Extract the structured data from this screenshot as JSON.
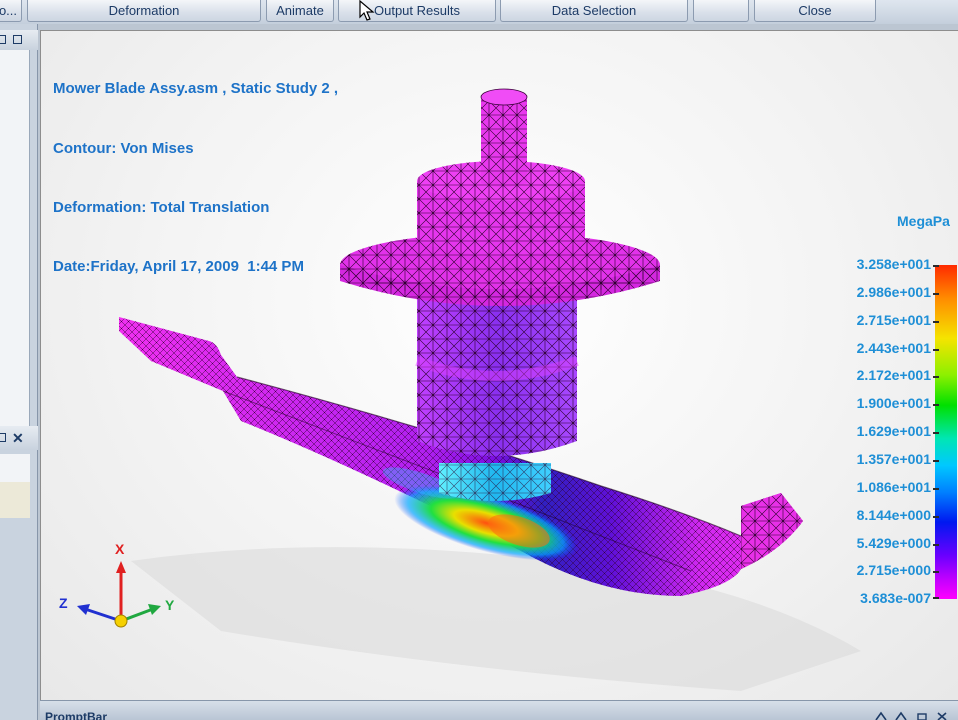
{
  "toolbar": {
    "truncated_label": "o...",
    "deformation": "Deformation",
    "animate": "Animate",
    "output_results": "Output Results",
    "data_selection": "Data Selection",
    "close": "Close"
  },
  "viewport": {
    "header": {
      "line1": "Mower Blade Assy.asm , Static Study 2 ,",
      "line2": "Contour: Von Mises",
      "line3": "Deformation: Total Translation",
      "line4": "Date:Friday, April 17, 2009  1:44 PM"
    },
    "legend": {
      "unit": "MegaPa",
      "values": [
        "3.258e+001",
        "2.986e+001",
        "2.715e+001",
        "2.443e+001",
        "2.172e+001",
        "1.900e+001",
        "1.629e+001",
        "1.357e+001",
        "1.086e+001",
        "8.144e+000",
        "5.429e+000",
        "2.715e+000",
        "3.683e-007"
      ],
      "colors": {
        "max": "#ff2a00",
        "mid": "#00e000",
        "min": "#ff00ff"
      }
    },
    "triad": {
      "x": "X",
      "y": "Y",
      "z": "Z"
    }
  },
  "promptbar": {
    "label": "PromptBar"
  },
  "colors": {
    "text_blue": "#1e73c8",
    "legend_blue": "#1e8fd6",
    "mesh_magenta": "#e828e8"
  }
}
